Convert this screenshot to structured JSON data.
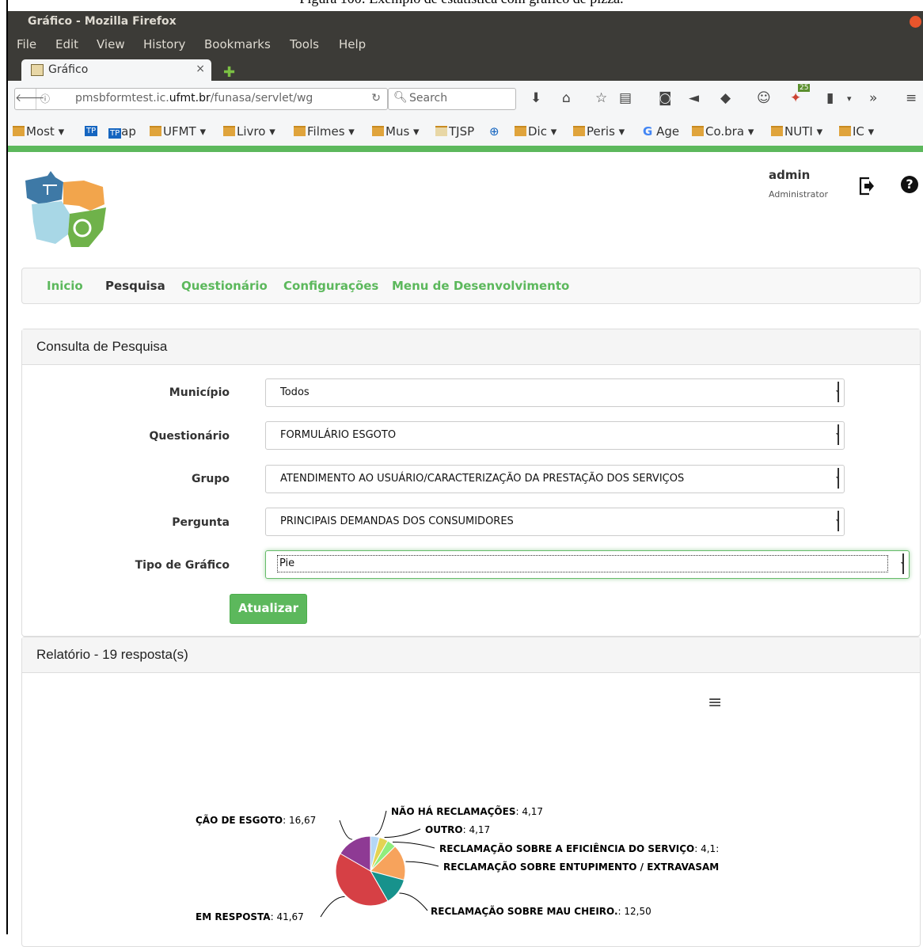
{
  "caption": "Figura 100: Exemplo de estatística com gráfico de pizza.",
  "window": {
    "title": "Gráfico - Mozilla Firefox"
  },
  "menu": [
    "File",
    "Edit",
    "View",
    "History",
    "Bookmarks",
    "Tools",
    "Help"
  ],
  "tab": {
    "label": "Gráfico",
    "close": "×"
  },
  "url": {
    "prefix": "pmsbformtest.ic.",
    "domain": "ufmt.br",
    "path": "/funasa/servlet/wg"
  },
  "search": {
    "placeholder": "Search"
  },
  "badge": "25",
  "bookmarks": [
    "Most",
    "ap",
    "UFMT",
    "Livro",
    "Filmes",
    "Mus",
    "TJSP",
    "Dic",
    "Peris",
    "Age",
    "Co.bra",
    "NUTI",
    "IC"
  ],
  "user": {
    "name": "admin",
    "role": "Administrator"
  },
  "nav": [
    "Inicio",
    "Pesquisa",
    "Questionário",
    "Configurações",
    "Menu de Desenvolvimento"
  ],
  "consulta": {
    "title": "Consulta de Pesquisa",
    "fields": [
      {
        "label": "Município",
        "value": "Todos"
      },
      {
        "label": "Questionário",
        "value": "FORMULÁRIO ESGOTO"
      },
      {
        "label": "Grupo",
        "value": "ATENDIMENTO AO USUÁRIO/CARACTERIZAÇÃO DA PRESTAÇÃO DOS SERVIÇOS"
      },
      {
        "label": "Pergunta",
        "value": "PRINCIPAIS DEMANDAS DOS CONSUMIDORES"
      },
      {
        "label": "Tipo de Gráfico",
        "value": "Pie"
      }
    ],
    "button": "Atualizar"
  },
  "relatorio": {
    "title": "Relatório - 19 resposta(s)"
  },
  "chart_data": {
    "type": "pie",
    "slices": [
      {
        "label": "NÃO HÁ RECLAMAÇÕES",
        "value": 4.17,
        "display": "4,17",
        "color": "#b5d7f5"
      },
      {
        "label": "OUTRO",
        "value": 4.17,
        "display": "4,17",
        "color": "#e4d354"
      },
      {
        "label": "RECLAMAÇÃO SOBRE A EFICIÊNCIA DO SERVIÇO",
        "value": 4.17,
        "display": "4,1:",
        "color": "#90ed7d"
      },
      {
        "label": "RECLAMAÇÃO SOBRE ENTUPIMENTO / EXTRAVASAM",
        "value": 16.67,
        "display": "",
        "color": "#f7a35c"
      },
      {
        "label": "RECLAMAÇÃO SOBRE MAU CHEIRO.",
        "value": 12.5,
        "display": "12,50",
        "color": "#17928c"
      },
      {
        "label": "EM RESPOSTA",
        "value": 41.67,
        "display": "41,67",
        "color": "#d64045"
      },
      {
        "label": "ÇÃO DE ESGOTO",
        "value": 16.67,
        "display": "16,67",
        "color": "#8e3a94"
      }
    ]
  }
}
